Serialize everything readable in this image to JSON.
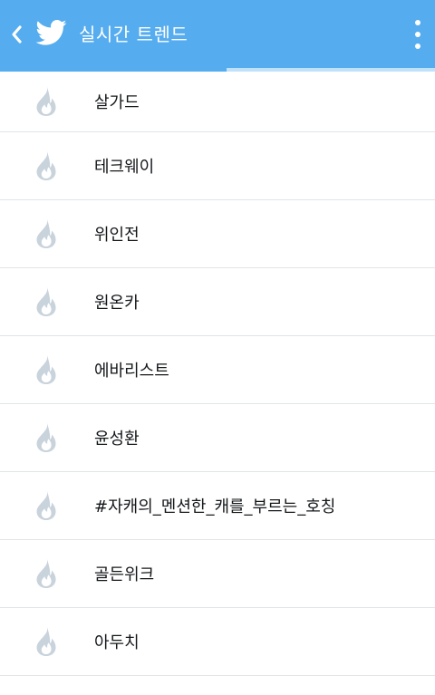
{
  "header": {
    "title": "실시간 트렌드",
    "progress_fraction": 0.52,
    "background_color": "#55acee",
    "icons": [
      "back-chevron-icon",
      "twitter-bird-icon",
      "more-vertical-icon"
    ]
  },
  "trends": {
    "icon": "flame-icon",
    "icon_color": "#c9d3dc",
    "items": [
      {
        "label": "살가드"
      },
      {
        "label": "테크웨이"
      },
      {
        "label": "위인전"
      },
      {
        "label": "원온카"
      },
      {
        "label": "에바리스트"
      },
      {
        "label": "윤성환"
      },
      {
        "label": "#자캐의_멘션한_캐를_부르는_호칭"
      },
      {
        "label": "골든위크"
      },
      {
        "label": "아두치"
      }
    ]
  }
}
